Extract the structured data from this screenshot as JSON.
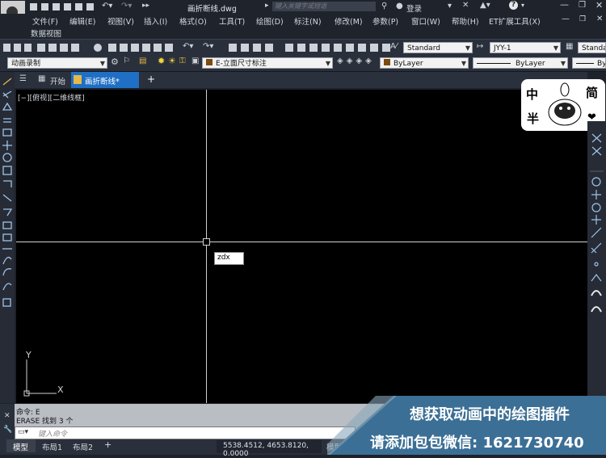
{
  "title_bar": {
    "filename": "画折断线.dwg",
    "search_placeholder": "键入关键字或短语",
    "login_label": "登录"
  },
  "menu": {
    "items": [
      "文件(F)",
      "编辑(E)",
      "视图(V)",
      "插入(I)",
      "格式(O)",
      "工具(T)",
      "绘图(D)",
      "标注(N)",
      "修改(M)",
      "参数(P)",
      "窗口(W)",
      "帮助(H)",
      "ET扩展工具(X)"
    ],
    "second_row": "数据视图"
  },
  "toolbar": {
    "text_style": "Standard",
    "dim_style": "JYY-1",
    "table_style": "Standa",
    "workspace": "动画录制",
    "layer": "E-立面尺寸标注",
    "color": "ByLayer",
    "linetype": "ByLayer",
    "lineweight": "By"
  },
  "tabs": {
    "start": "开始",
    "drawing": "画折断线*",
    "add": "+"
  },
  "viewport_label": "[−][俯视][二维线框]",
  "cursor_input": "zdx",
  "ucs": {
    "y": "Y",
    "x": "X"
  },
  "command": {
    "line1": "命令: E",
    "line2": "ERASE 找到 3 个",
    "placeholder": "键入命令"
  },
  "layout_tabs": [
    "模型",
    "布局1",
    "布局2",
    "+"
  ],
  "status": {
    "coords": "5538.4512, 4653.8120, 0.0000",
    "mode": "模型"
  },
  "sticker": {
    "tl": "中",
    "tr": "简",
    "bl": "半",
    "br": "❤"
  },
  "banner": {
    "line1": "想获取动画中的绘图插件",
    "line2": "请添加包包微信: 1621730740"
  },
  "colors": {
    "accent": "#1f6fc5",
    "canvas": "#000000",
    "crosshair": "#d0d0d0"
  }
}
